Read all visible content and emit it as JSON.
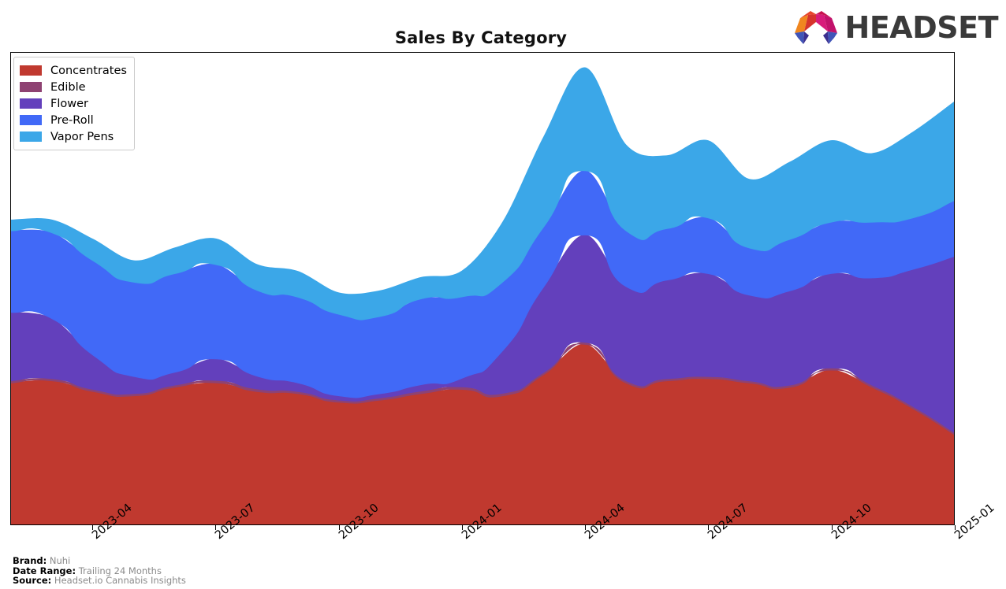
{
  "header": {
    "title": "Sales By Category",
    "logo_text": "HEADSET",
    "logo_mark_name": "headset-arch-logo",
    "logo_colors": [
      "#e8452c",
      "#f0861f",
      "#d81b7a",
      "#c7134f",
      "#4055b8",
      "#3b2f8f"
    ]
  },
  "legend": {
    "position": "top-left",
    "items": [
      {
        "label": "Concentrates",
        "color": "#c0392f"
      },
      {
        "label": "Edible",
        "color": "#8e4272"
      },
      {
        "label": "Flower",
        "color": "#6340bc"
      },
      {
        "label": "Pre-Roll",
        "color": "#4169f7"
      },
      {
        "label": "Vapor Pens",
        "color": "#3ba7e8"
      }
    ]
  },
  "footer": {
    "rows": [
      {
        "key": "Brand:",
        "value": "Nuhi"
      },
      {
        "key": "Date Range:",
        "value": "Trailing 24 Months"
      },
      {
        "key": "Source:",
        "value": "Headset.io Cannabis Insights"
      }
    ]
  },
  "chart_data": {
    "type": "area",
    "variant": "stacked-area-smoothed",
    "title": "Sales By Category",
    "xlabel": "",
    "ylabel": "",
    "grid": false,
    "legend_position": "top-left",
    "axis_tick_labels": [
      "2023-04",
      "2023-07",
      "2023-10",
      "2024-01",
      "2024-04",
      "2024-07",
      "2024-10",
      "2025-01"
    ],
    "x": [
      "2023-02",
      "2023-03",
      "2023-04",
      "2023-05",
      "2023-06",
      "2023-07",
      "2023-08",
      "2023-09",
      "2023-10",
      "2023-11",
      "2023-12",
      "2024-01",
      "2024-02",
      "2024-03",
      "2024-04",
      "2024-05",
      "2024-06",
      "2024-07",
      "2024-08",
      "2024-09",
      "2024-10",
      "2024-11",
      "2024-12",
      "2025-01"
    ],
    "series": [
      {
        "name": "Concentrates",
        "color": "#c0392f",
        "values": [
          33,
          33.5,
          31,
          30,
          32,
          33,
          31,
          30.5,
          28.5,
          29,
          30.5,
          31.5,
          30,
          35,
          42,
          33,
          33.5,
          34,
          33,
          32,
          36,
          32,
          27,
          21
        ]
      },
      {
        "name": "Edible",
        "color": "#8e4272",
        "values": [
          0.5,
          0.5,
          0.5,
          0.5,
          0.5,
          0.6,
          0.6,
          0.5,
          0.5,
          0.5,
          0.6,
          0.6,
          0.6,
          0.5,
          0.5,
          0.5,
          0.5,
          0.5,
          0.5,
          0.5,
          0.5,
          0.5,
          0.5,
          0.5
        ]
      },
      {
        "name": "Flower",
        "color": "#6340bc",
        "values": [
          16,
          14,
          8,
          4,
          3,
          5,
          3,
          2,
          1,
          1,
          1.5,
          2,
          10,
          20,
          25,
          22,
          23,
          24,
          20,
          22,
          22,
          25,
          32,
          41
        ]
      },
      {
        "name": "Pre-Roll",
        "color": "#4169f7",
        "values": [
          19,
          20,
          22,
          22,
          23,
          22,
          20,
          20,
          19,
          18,
          20,
          19,
          16,
          14,
          15,
          13,
          12,
          13,
          11,
          12,
          12,
          13,
          12,
          13
        ]
      },
      {
        "name": "Vapor Pens",
        "color": "#3ba7e8",
        "values": [
          2.5,
          3,
          5,
          5,
          6,
          6,
          6,
          6,
          5,
          6,
          5,
          6,
          14,
          21,
          24,
          20,
          17,
          18,
          16,
          18,
          19,
          16,
          20,
          23
        ]
      }
    ],
    "x_index_of_ticks": [
      2,
      5,
      8,
      11,
      14,
      17,
      20,
      23
    ],
    "ylim": [
      0,
      110
    ],
    "baseline": "wiggle"
  }
}
